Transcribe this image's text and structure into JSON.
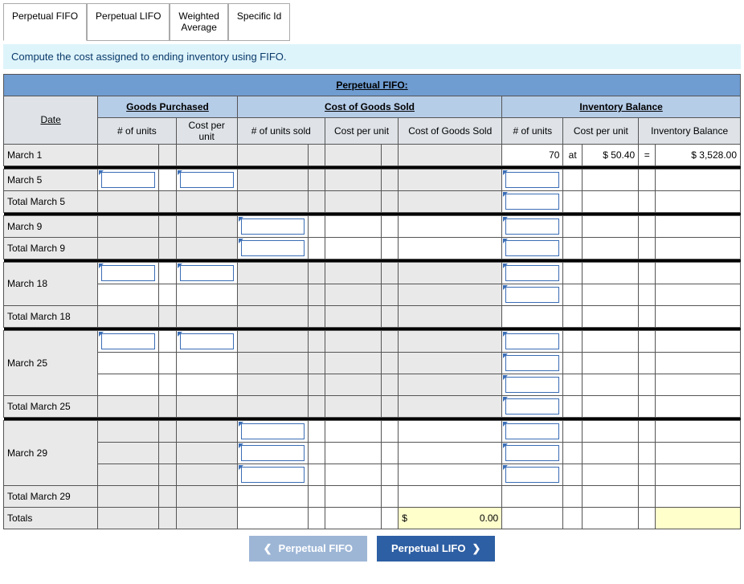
{
  "tabs": {
    "t1": "Perpetual FIFO",
    "t2": "Perpetual LIFO",
    "t3": "Weighted\nAverage",
    "t4": "Specific Id"
  },
  "instruction": "Compute the cost assigned to ending inventory using FIFO.",
  "headers": {
    "title": "Perpetual FIFO:",
    "date": "Date",
    "goods_purchased": "Goods Purchased",
    "cogs": "Cost of Goods Sold",
    "inventory_balance": "Inventory Balance",
    "num_units": "# of units",
    "cost_per_unit": "Cost per unit",
    "num_units_sold": "# of units sold",
    "cogs_val": "Cost of Goods Sold",
    "inv_balance": "Inventory Balance"
  },
  "rows": {
    "march1": "March 1",
    "march5": "March 5",
    "total_march5": "Total March 5",
    "march9": "March 9",
    "total_march9": "Total March 9",
    "march18": "March 18",
    "total_march18": "Total March 18",
    "march25": "March 25",
    "total_march25": "Total March 25",
    "march29": "March 29",
    "total_march29": "Total March 29",
    "totals": "Totals"
  },
  "values": {
    "m1_units": "70",
    "m1_at": "at",
    "m1_cost": "$ 50.40",
    "m1_eq": "=",
    "m1_balance": "$   3,528.00",
    "totals_cogs_sym": "$",
    "totals_cogs_val": "0.00"
  },
  "nav": {
    "prev": "Perpetual FIFO",
    "next": "Perpetual LIFO"
  }
}
